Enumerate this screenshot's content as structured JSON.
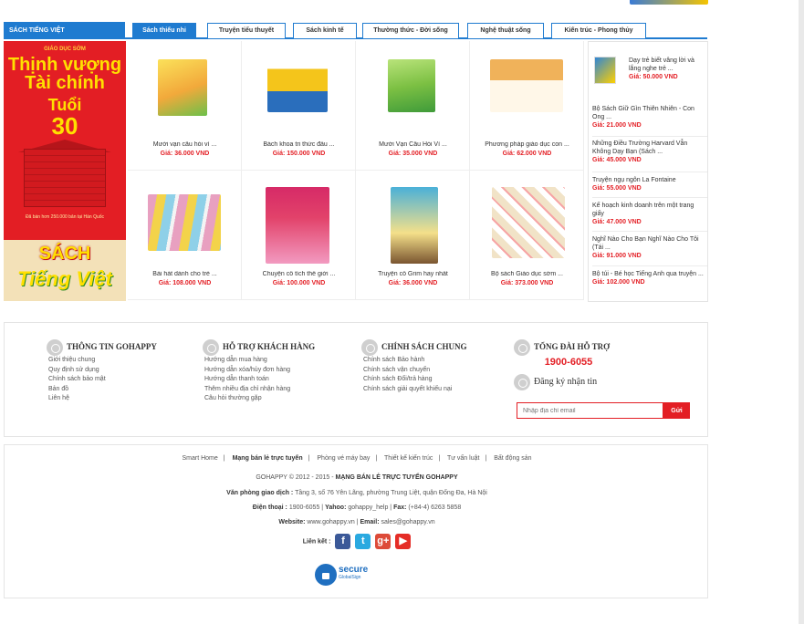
{
  "category": {
    "title": "SÁCH TIẾNG VIỆT",
    "tabs": [
      {
        "label": "Sách thiếu nhi",
        "active": true
      },
      {
        "label": "Truyện tiểu thuyết",
        "active": false
      },
      {
        "label": "Sách kinh tế",
        "active": false
      },
      {
        "label": "Thường thức - Đời sống",
        "active": false
      },
      {
        "label": "Nghệ thuật sống",
        "active": false
      },
      {
        "label": "Kiến trúc - Phong thủy",
        "active": false
      }
    ]
  },
  "banner": {
    "publisher": "GIÁO DỤC SỚM",
    "line1": "Thịnh vượng",
    "line2": "Tài chính",
    "line3": "Tuổi",
    "line4": "30",
    "note": "Đã bán hơn 250.000 bản tại Hàn Quốc",
    "brand1": "SÁCH",
    "brand2": "Tiếng Việt"
  },
  "products": [
    {
      "name": "Mười vạn câu hỏi vì ...",
      "price": "Giá: 36.000 VND",
      "color": "#f2a93b"
    },
    {
      "name": "Bách khoa tri thức đầu ...",
      "price": "Giá: 150.000 VND",
      "color": "#f4c51b"
    },
    {
      "name": "Mười Vạn Câu Hỏi Vì ...",
      "price": "Giá: 35.000 VND",
      "color": "#7cc043"
    },
    {
      "name": "Phương pháp giáo dục con ...",
      "price": "Giá: 62.000 VND",
      "color": "#f0b25a"
    },
    {
      "name": "Bài hát dành cho trẻ ...",
      "price": "Giá: 108.000 VND",
      "color": "#e8a0c0"
    },
    {
      "name": "Chuyện cổ tích thế giới ...",
      "price": "Giá: 100.000 VND",
      "color": "#e2426a"
    },
    {
      "name": "Truyện cổ Grim hay nhất",
      "price": "Giá: 36.000 VND",
      "color": "#4ab0d8"
    },
    {
      "name": "Bộ sách Giáo dục sớm ...",
      "price": "Giá: 373.000 VND",
      "color": "#f1e3c7"
    }
  ],
  "sidebar_list": [
    {
      "name": "Dạy trẻ biết vâng lời và lắng nghe trẻ ...",
      "price": "Giá: 50.000 VND"
    },
    {
      "name": "Bộ Sách Giữ Gìn Thiên Nhiên - Con Ong ...",
      "price": "Giá: 21.000 VND"
    },
    {
      "name": "Những Điều Trường Harvard Vẫn Không Dạy Bạn (Sách ...",
      "price": "Giá: 45.000 VND"
    },
    {
      "name": "Truyện ngụ ngôn La Fontaine",
      "price": "Giá: 55.000 VND"
    },
    {
      "name": "Kế hoạch kinh doanh trên một trang giấy",
      "price": "Giá: 47.000 VND"
    },
    {
      "name": "Nghĩ Nào Cho Bạn Nghĩ Nào Cho Tôi (Tái ...",
      "price": "Giá: 91.000 VND"
    },
    {
      "name": "Bộ túi - Bé học Tiếng Anh qua truyện ...",
      "price": "Giá: 102.000 VND"
    }
  ],
  "footer": {
    "col1": {
      "title": "THÔNG TIN GOHAPPY",
      "links": [
        "Giới thiệu chung",
        "Quy định sử dụng",
        "Chính sách bảo mật",
        "Bản đồ",
        "Liên hệ"
      ]
    },
    "col2": {
      "title": "HỖ TRỢ KHÁCH HÀNG",
      "links": [
        "Hướng dẫn mua hàng",
        "Hướng dẫn xóa/hủy đơn hàng",
        "Hướng dẫn thanh toán",
        "Thêm nhiều địa chỉ nhận hàng",
        "Câu hỏi thường gặp"
      ]
    },
    "col3": {
      "title": "CHÍNH SÁCH CHUNG",
      "links": [
        "Chính sách Bảo hành",
        "Chính sách vận chuyển",
        "Chính sách Đổi/trả hàng",
        "Chính sách giải quyết khiếu nại"
      ]
    },
    "col4": {
      "title": "TỔNG ĐÀI HỖ TRỢ",
      "hotline": "1900-6055",
      "newsletter": "Đăng ký nhận tin",
      "email_placeholder": "Nhập địa chỉ email",
      "submit": "Gửi"
    },
    "links": [
      "Smart Home",
      "Mạng bán lẻ trực tuyến",
      "Phòng vé máy bay",
      "Thiết kế kiến trúc",
      "Tư vấn luật",
      "Bất động sản"
    ],
    "copyright_prefix": "GOHAPPY © 2012 - 2015 -",
    "copyright_strong": "MẠNG BÁN LẺ TRỰC TUYẾN GOHAPPY",
    "office_label": "Văn phòng giao dịch :",
    "office": "Tầng 3, số 76 Yên Lãng, phường Trung Liệt, quận Đống Đa, Hà Nội",
    "phone_label": "Điện thoại :",
    "phone": "1900-6055 |",
    "yahoo_label": "Yahoo:",
    "yahoo": "gohappy_help |",
    "fax_label": "Fax:",
    "fax": "(+84-4) 6263 5858",
    "website_label": "Website:",
    "website": "www.gohappy.vn |",
    "email_label": "Email:",
    "email": "sales@gohappy.vn",
    "connect_label": "Liên kết :",
    "social": [
      {
        "name": "facebook",
        "glyph": "f",
        "color": "#3b5998"
      },
      {
        "name": "twitter",
        "glyph": "t",
        "color": "#2aa9e0"
      },
      {
        "name": "google-plus",
        "glyph": "g+",
        "color": "#dd4b39"
      },
      {
        "name": "youtube",
        "glyph": "▶",
        "color": "#e52d27"
      }
    ],
    "secure_title": "secure",
    "secure_sub": "GlobalSign"
  }
}
